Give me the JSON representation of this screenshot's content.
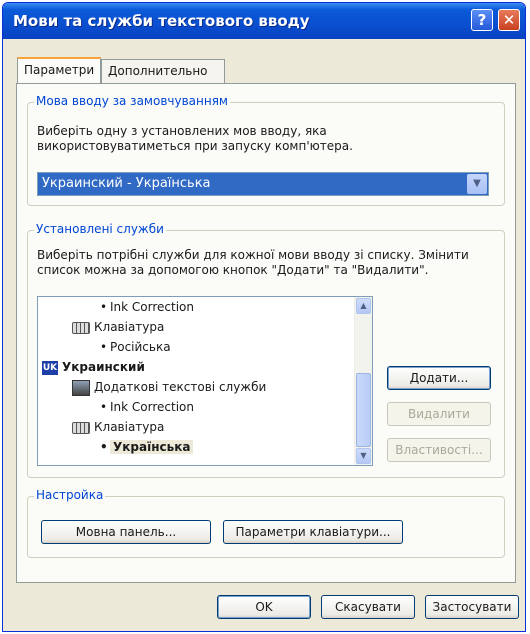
{
  "window": {
    "title": "Мови та служби текстового вводу",
    "help_label": "?",
    "close_label": "✕"
  },
  "tabs": [
    {
      "label": "Параметри",
      "active": true
    },
    {
      "label": "Дополнительно",
      "active": false
    }
  ],
  "default_language": {
    "group_title": "Мова вводу за замовчуванням",
    "description_line1": "Виберіть одну з установлених мов вводу, яка",
    "description_line2": "використовуватиметься при запуску комп'ютера.",
    "selected_value": "Украинский - Українська"
  },
  "installed_services": {
    "group_title": "Установлені служби",
    "description_line1": "Виберіть потрібні служби для кожної мови вводу зі списку. Змінити",
    "description_line2": "список можна за допомогою кнопок \"Додати\" та \"Видалити\".",
    "tree": [
      {
        "text": "Ink Correction",
        "type": "bullet",
        "level": 2
      },
      {
        "text": "Клавіатура",
        "type": "keyboard",
        "level": 1
      },
      {
        "text": "Російська",
        "type": "bullet",
        "level": 2
      },
      {
        "text": "Украинский",
        "type": "language",
        "level": 0,
        "badge": "UK"
      },
      {
        "text": "Додаткові текстові служби",
        "type": "service",
        "level": 1
      },
      {
        "text": "Ink Correction",
        "type": "bullet",
        "level": 2
      },
      {
        "text": "Клавіатура",
        "type": "keyboard",
        "level": 1
      },
      {
        "text": "Українська",
        "type": "bullet",
        "level": 2,
        "selected": true
      }
    ],
    "buttons": {
      "add": "Додати...",
      "remove": "Видалити",
      "properties": "Властивості..."
    }
  },
  "settings": {
    "group_title": "Настройка",
    "language_bar_button": "Мовна панель...",
    "keyboard_settings_button": "Параметри клавіатури..."
  },
  "footer": {
    "ok": "OK",
    "cancel": "Скасувати",
    "apply": "Застосувати"
  }
}
